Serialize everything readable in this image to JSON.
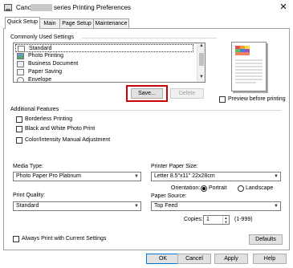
{
  "window": {
    "title_prefix": "Canon",
    "title_suffix": "series Printing Preferences",
    "close_glyph": "✕"
  },
  "tabs": [
    {
      "label": "Quick Setup",
      "active": true
    },
    {
      "label": "Main"
    },
    {
      "label": "Page Setup"
    },
    {
      "label": "Maintenance"
    }
  ],
  "commonly_used": {
    "heading": "Commonly Used Settings",
    "items": [
      {
        "label": "Standard",
        "icon": "standard-icon",
        "selected": true
      },
      {
        "label": "Photo Printing",
        "icon": "photo-icon"
      },
      {
        "label": "Business Document",
        "icon": "document-icon"
      },
      {
        "label": "Paper Saving",
        "icon": "paper-saving-icon"
      },
      {
        "label": "Envelope",
        "icon": "envelope-icon"
      }
    ],
    "save_label": "Save...",
    "delete_label": "Delete",
    "preview_label": "Preview before printing"
  },
  "additional": {
    "heading": "Additional Features",
    "items": [
      {
        "label": "Borderless Printing"
      },
      {
        "label": "Black and White Photo Print"
      },
      {
        "label": "Color/Intensity Manual Adjustment"
      }
    ]
  },
  "media": {
    "media_type_label": "Media Type:",
    "media_type_value": "Photo Paper Pro Platinum",
    "print_quality_label": "Print Quality:",
    "print_quality_value": "Standard"
  },
  "paper": {
    "printer_paper_size_label": "Printer Paper Size:",
    "printer_paper_size_value": "Letter 8.5\"x11\" 22x28cm",
    "orientation_label": "Orientation:",
    "portrait_label": "Portrait",
    "landscape_label": "Landscape",
    "orientation_selected": "Portrait",
    "paper_source_label": "Paper Source:",
    "paper_source_value": "Top Feed",
    "copies_label": "Copies:",
    "copies_value": "1",
    "copies_range": "(1-999)"
  },
  "always_print_label": "Always Print with Current Settings",
  "defaults_label": "Defaults",
  "footer": {
    "ok_label": "OK",
    "cancel_label": "Cancel",
    "apply_label": "Apply",
    "help_label": "Help"
  },
  "colors": {
    "highlight": "#c8000a"
  }
}
